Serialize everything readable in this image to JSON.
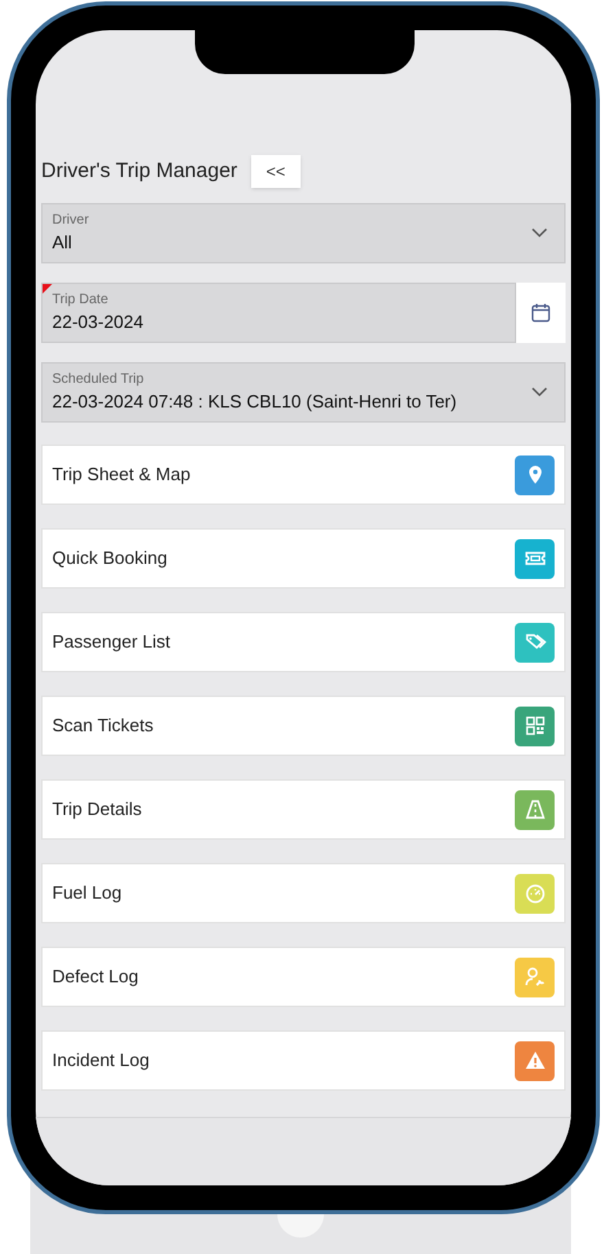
{
  "header": {
    "title": "Driver's Trip Manager",
    "collapse_button": "<<"
  },
  "fields": [
    {
      "kind": "select",
      "label": "Driver",
      "value": "All",
      "required": false
    },
    {
      "kind": "date",
      "label": "Trip Date",
      "value": "22-03-2024",
      "required": true
    },
    {
      "kind": "select",
      "label": "Scheduled Trip",
      "value": "22-03-2024 07:48 : KLS CBL10 (Saint-Henri to Ter)",
      "required": false
    }
  ],
  "menu": [
    {
      "label": "Trip Sheet & Map",
      "kind": "pin",
      "color": "#3a9bdc"
    },
    {
      "label": "Quick Booking",
      "kind": "ticket",
      "color": "#17b2cf"
    },
    {
      "label": "Passenger List",
      "kind": "tags",
      "color": "#2ec1bf"
    },
    {
      "label": "Scan Tickets",
      "kind": "qr",
      "color": "#39a57b"
    },
    {
      "label": "Trip Details",
      "kind": "road",
      "color": "#7ab85c"
    },
    {
      "label": "Fuel Log",
      "kind": "gauge",
      "color": "#d9dd55"
    },
    {
      "label": "Defect Log",
      "kind": "mechanic",
      "color": "#f6c945"
    },
    {
      "label": "Incident Log",
      "kind": "warning",
      "color": "#ee8540"
    }
  ]
}
